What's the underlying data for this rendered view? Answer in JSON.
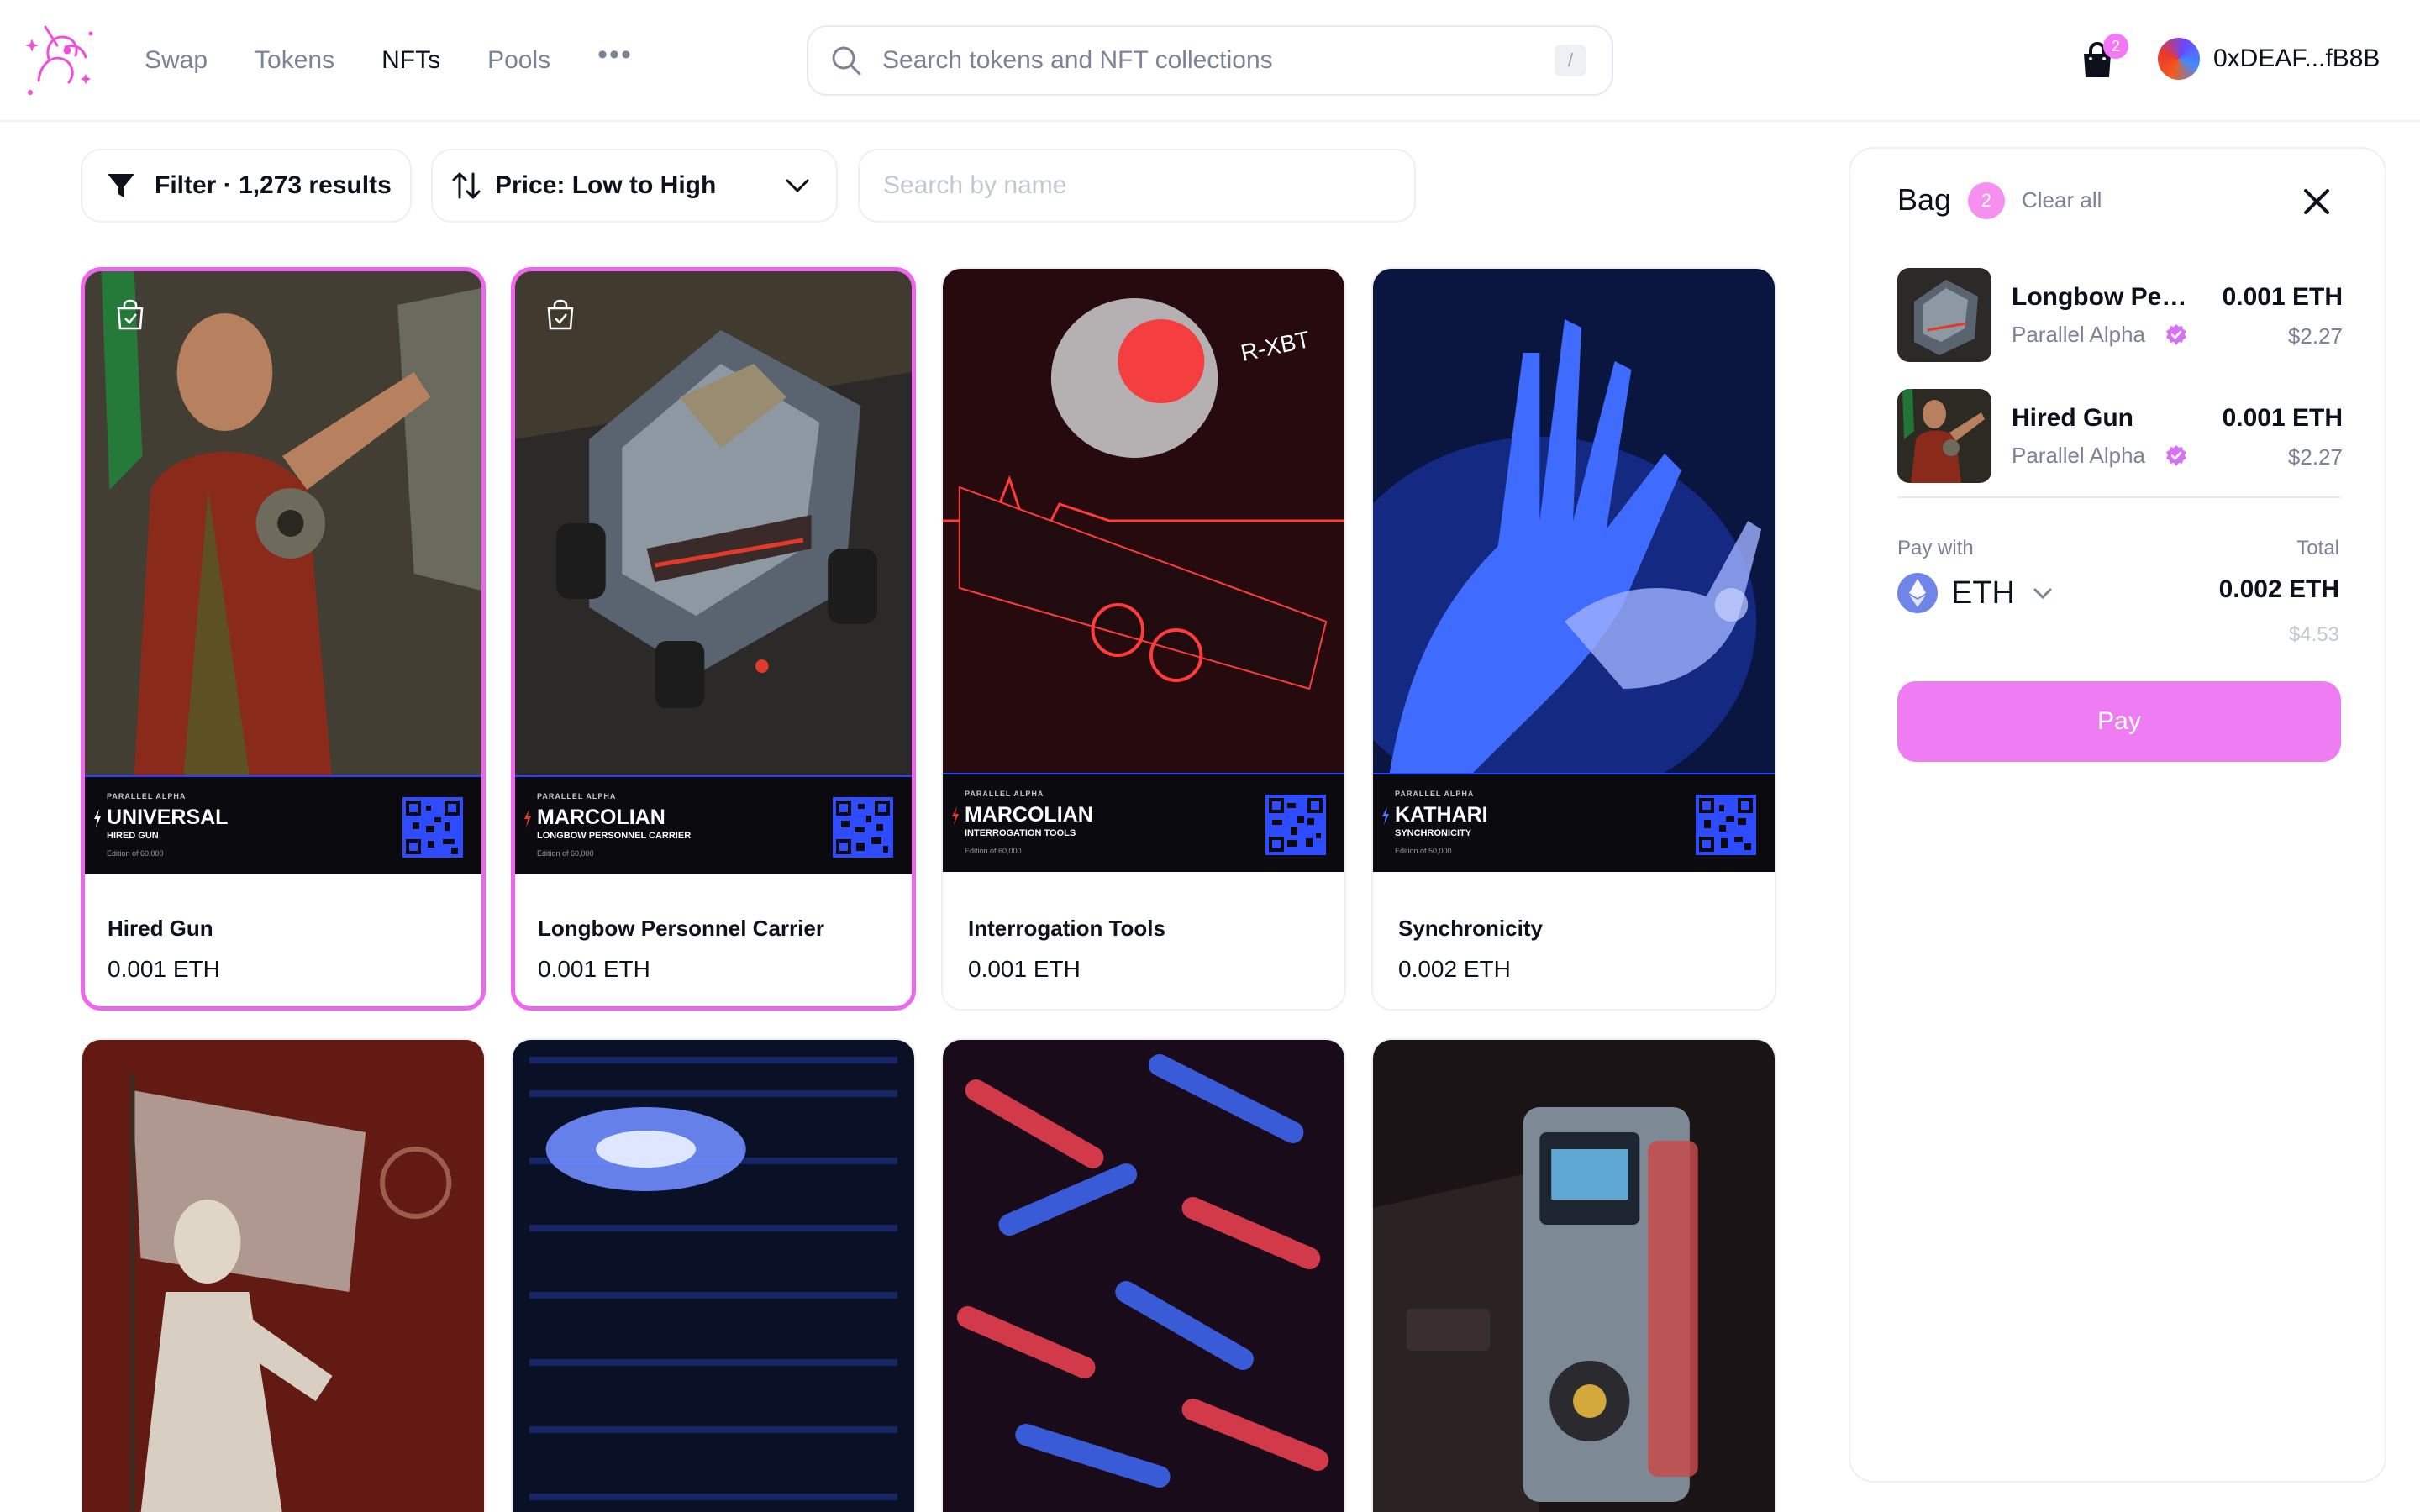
{
  "header": {
    "nav": [
      "Swap",
      "Tokens",
      "NFTs",
      "Pools"
    ],
    "active_nav": "NFTs",
    "search_placeholder": "Search tokens and NFT collections",
    "search_shortcut": "/",
    "bag_count": "2",
    "account_address": "0xDEAF...fB8B"
  },
  "toolbar": {
    "filter_label": "Filter · 1,273 results",
    "sort_label": "Price: Low to High",
    "name_search_placeholder": "Search by name"
  },
  "cards": [
    {
      "title": "Hired Gun",
      "price": "0.001 ETH",
      "selected": true,
      "card_brand": "PARALLEL ALPHA",
      "card_faction": "UNIVERSAL",
      "card_sub": "HIRED GUN",
      "card_edition": "Edition of 60,000"
    },
    {
      "title": "Longbow Personnel Carrier",
      "price": "0.001 ETH",
      "selected": true,
      "card_brand": "PARALLEL ALPHA",
      "card_faction": "MARCOLIAN",
      "card_sub": "LONGBOW PERSONNEL CARRIER",
      "card_edition": "Edition of 60,000"
    },
    {
      "title": "Interrogation Tools",
      "price": "0.001 ETH",
      "selected": false,
      "card_brand": "PARALLEL ALPHA",
      "card_faction": "MARCOLIAN",
      "card_sub": "INTERROGATION TOOLS",
      "card_edition": "Edition of 60,000"
    },
    {
      "title": "Synchronicity",
      "price": "0.002 ETH",
      "selected": false,
      "card_brand": "PARALLEL ALPHA",
      "card_faction": "KATHARI",
      "card_sub": "SYNCHRONICITY",
      "card_edition": "Edition of 50,000"
    }
  ],
  "bag": {
    "title": "Bag",
    "count": "2",
    "clear_all": "Clear all",
    "items": [
      {
        "name": "Longbow Personnel Carrier",
        "collection": "Parallel Alpha",
        "eth": "0.001 ETH",
        "usd": "$2.27"
      },
      {
        "name": "Hired Gun",
        "collection": "Parallel Alpha",
        "eth": "0.001 ETH",
        "usd": "$2.27"
      }
    ],
    "pay_with_label": "Pay with",
    "currency": "ETH",
    "total_label": "Total",
    "total_eth": "0.002 ETH",
    "total_usd": "$4.53",
    "pay_button": "Pay"
  },
  "colors": {
    "accent_pink": "#f065ee",
    "pay_button": "#f07cf3",
    "muted_text": "#7d8397"
  }
}
